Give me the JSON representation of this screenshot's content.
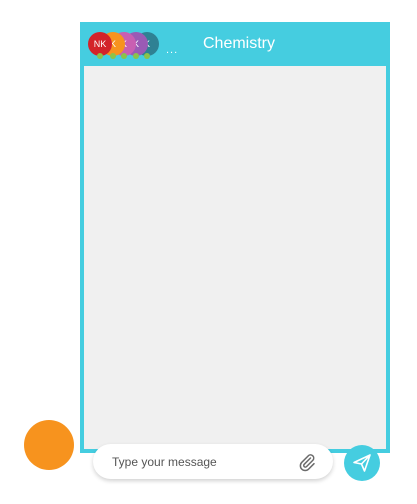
{
  "chat": {
    "title": "Chemistry",
    "more_indicator": "...",
    "participants": [
      {
        "initials": "NK",
        "color": "#d3232a"
      },
      {
        "initials": "K",
        "color": "#f7931e"
      },
      {
        "initials": "K",
        "color": "#c95fb2"
      },
      {
        "initials": "K",
        "color": "#9a5bb5"
      },
      {
        "initials": "K",
        "color": "#2f8193"
      }
    ]
  },
  "composer": {
    "placeholder": "Type your message",
    "attach_icon": "paperclip-icon",
    "send_icon": "paper-plane-icon"
  },
  "colors": {
    "accent": "#45cde0",
    "message_area": "#f0f0f0",
    "launcher": "#f7931e",
    "online": "#8bc34a"
  }
}
